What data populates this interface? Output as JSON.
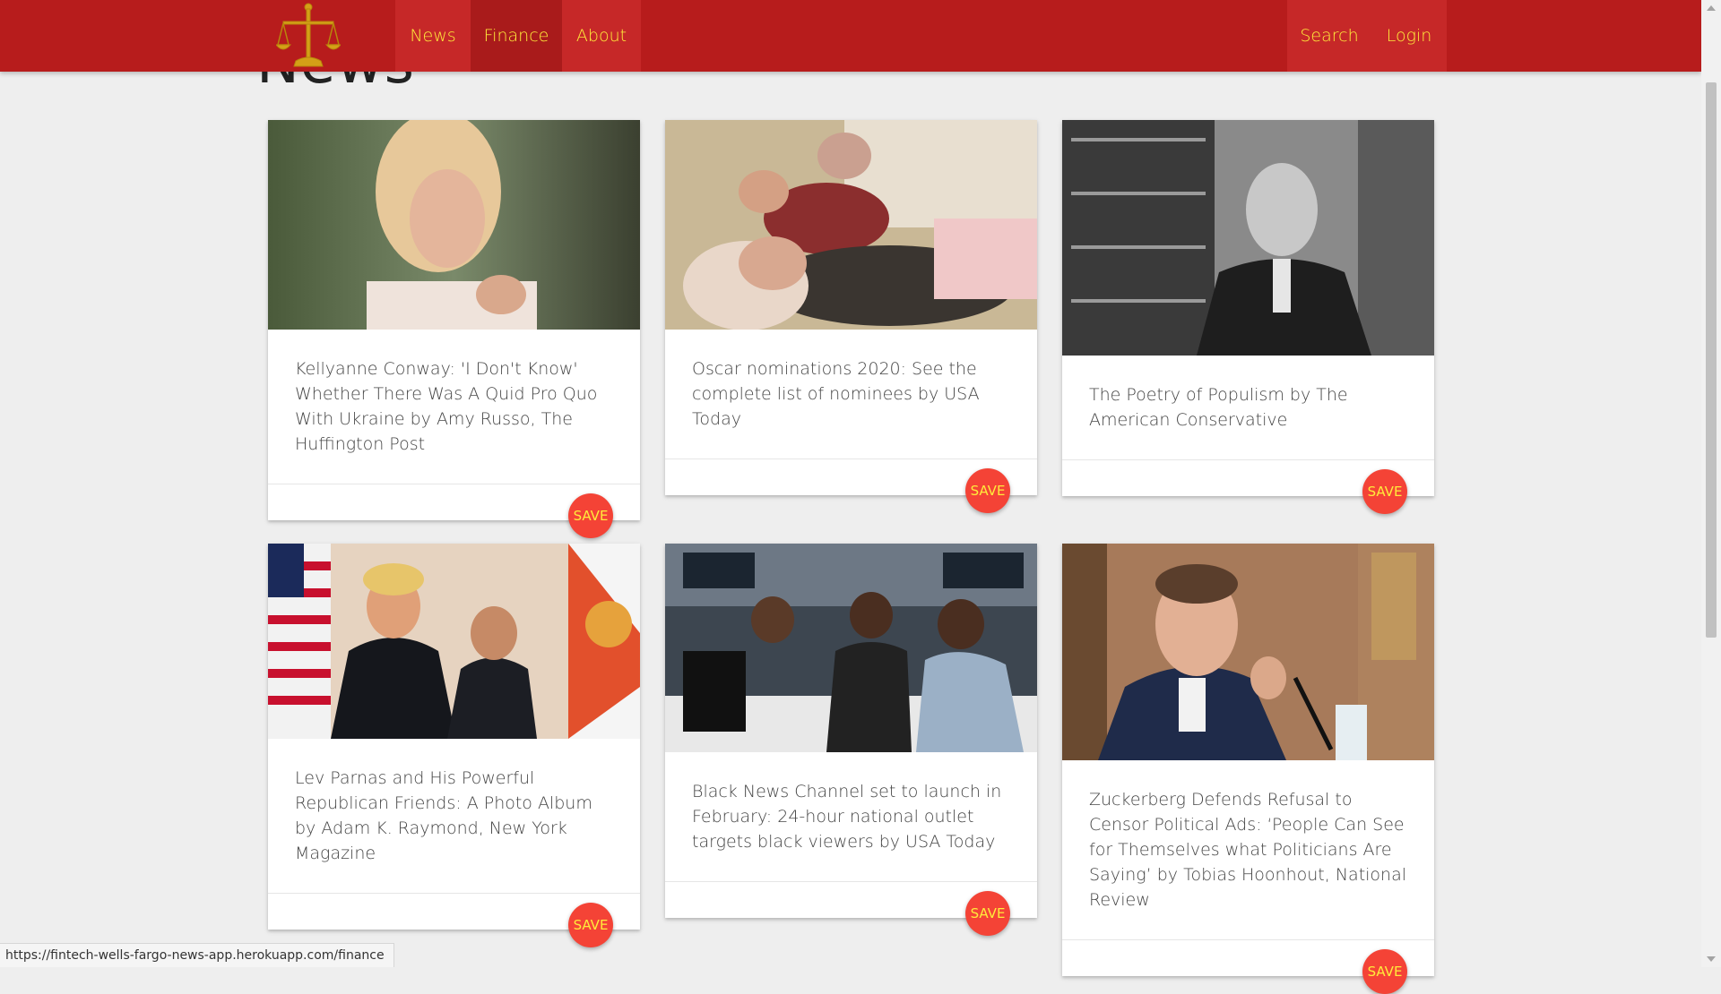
{
  "nav": {
    "logo_icon": "scales-of-justice-icon",
    "left_links": [
      "News",
      "Finance",
      "About"
    ],
    "active": "Finance",
    "right_links": [
      "Search",
      "Login"
    ]
  },
  "page": {
    "heading": "News"
  },
  "cards": [
    {
      "title": "Kellyanne Conway: 'I Don't Know' Whether There Was A Quid Pro Quo With Ukraine by Amy Russo, The Huffington Post",
      "save_label": "SAVE",
      "image": "woman-speaking-photo"
    },
    {
      "title": "Oscar nominations 2020: See the complete list of nominees by USA Today",
      "save_label": "SAVE",
      "image": "family-in-bed-photo"
    },
    {
      "title": "The Poetry of Populism by The American Conservative",
      "save_label": "SAVE",
      "image": "man-by-bookshelf-photo"
    },
    {
      "title": "Lev Parnas and His Powerful Republican Friends: A Photo Album by Adam K. Raymond, New York Magazine",
      "save_label": "SAVE",
      "image": "two-men-flags-photo"
    },
    {
      "title": "Black News Channel set to launch in February: 24-hour national outlet targets black viewers by USA Today",
      "save_label": "SAVE",
      "image": "newsroom-photo"
    },
    {
      "title": "Zuckerberg Defends Refusal to Censor Political Ads: ‘People Can See for Themselves what Politicians Are Saying’ by Tobias Hoonhout, National Review",
      "save_label": "SAVE",
      "image": "man-testifying-photo"
    }
  ],
  "status_url": "https://fintech-wells-fargo-news-app.herokuapp.com/finance",
  "colors": {
    "nav_bg": "#b71c1c",
    "nav_text": "#ffeb3b",
    "save_bg": "#f44336",
    "page_bg": "#eeeeee"
  }
}
